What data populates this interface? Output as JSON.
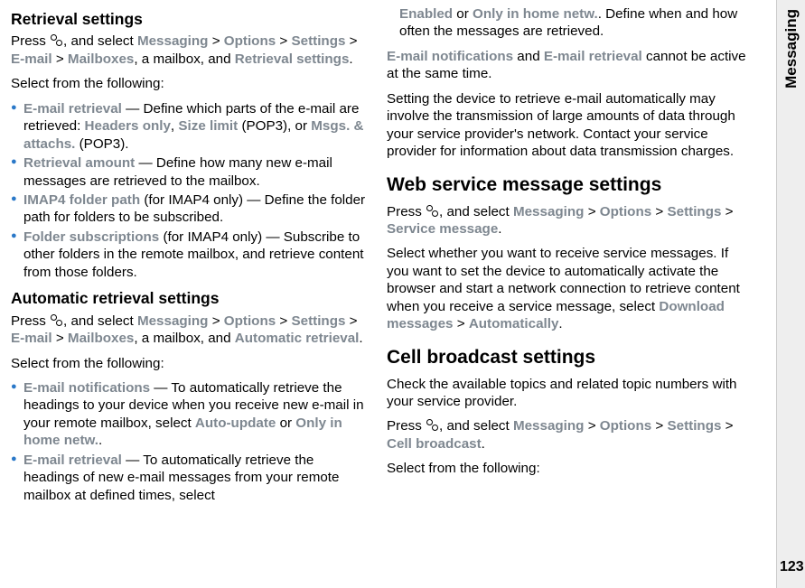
{
  "side": {
    "label": "Messaging",
    "pagenum": "123"
  },
  "left": {
    "h1": "Retrieval settings",
    "p1_a": "Press ",
    "p1_b": ", and select ",
    "msg": "Messaging",
    "opt": "Options",
    "set": "Settings",
    "em": "E-mail",
    "mb": "Mailboxes",
    "p1_c": ", a mailbox, and ",
    "retr": "Retrieval settings",
    "period": ".",
    "select": "Select from the following:",
    "li1_a": "E-mail retrieval",
    "li1_b": "  — Define which parts of the e-mail are retrieved: ",
    "li1_c": "Headers only",
    "li1_d": ", ",
    "li1_e": "Size limit",
    "li1_f": " (POP3), or ",
    "li1_g": "Msgs. & attachs.",
    "li1_h": " (POP3).",
    "li2_a": "Retrieval amount",
    "li2_b": "  — Define how many new e-mail messages are retrieved to the mailbox.",
    "li3_a": "IMAP4 folder path",
    "li3_b": " (for IMAP4 only)  — Define the folder path for folders to be subscribed.",
    "li4_a": "Folder subscriptions",
    "li4_b": " (for IMAP4 only)  — Subscribe to other folders in the remote mailbox, and retrieve content from those folders.",
    "h2": "Automatic retrieval settings",
    "p2_c": ", a mailbox, and ",
    "auto": "Automatic retrieval",
    "li5_a": "E-mail notifications",
    "li5_b": "  — To automatically retrieve the headings to your device when you receive new e-mail in your remote mailbox, select ",
    "li5_c": "Auto-update",
    "li5_d": " or ",
    "li5_e": "Only in home netw.",
    "li5_f": ".",
    "li6_a": "E-mail retrieval",
    "li6_b": "  — To automatically retrieve the headings of new e-mail messages from your remote mailbox at defined times, select "
  },
  "right": {
    "top_a": "Enabled",
    "top_b": " or ",
    "top_c": "Only in home netw.",
    "top_d": ". Define when and how often the messages are retrieved.",
    "p1_a": "E-mail notifications",
    "p1_b": " and ",
    "p1_c": "E-mail retrieval",
    "p1_d": " cannot be active at the same time.",
    "p2": "Setting the device to retrieve e-mail automatically may involve the transmission of large amounts of data through your service provider's network. Contact your service provider for information about data transmission charges.",
    "h1": "Web service message settings",
    "p3_a": "Press ",
    "p3_b": ", and select ",
    "sm": "Service message",
    "p4_a": "Select whether you want to receive service messages. If you want to set the device to automatically activate the browser and start a network connection to retrieve content when you receive a service message, select ",
    "dm": "Download messages",
    "auto": "Automatically",
    "h2": "Cell broadcast settings",
    "p5": "Check the available topics and related topic numbers with your service provider.",
    "p6_a": "Press ",
    "p6_b": ", and select ",
    "cb": "Cell broadcast",
    "select": "Select from the following:"
  },
  "gt": ">"
}
